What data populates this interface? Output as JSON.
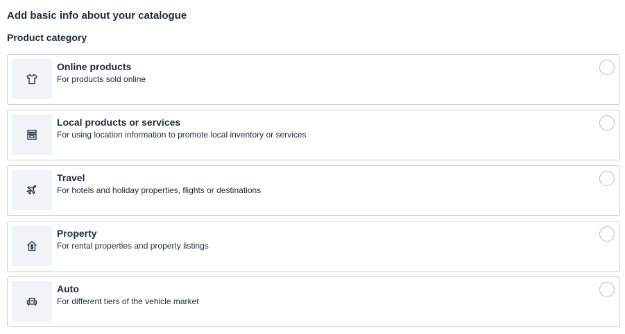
{
  "header": {
    "title": "Add basic info about your catalogue",
    "section_label": "Product category"
  },
  "options": [
    {
      "title": "Online products",
      "description": "For products sold online",
      "icon": "shirt-icon",
      "selected": false
    },
    {
      "title": "Local products or services",
      "description": "For using location information to promote local inventory or services",
      "icon": "storefront-icon",
      "selected": false
    },
    {
      "title": "Travel",
      "description": "For hotels and holiday properties, flights or destinations",
      "icon": "airplane-icon",
      "selected": false
    },
    {
      "title": "Property",
      "description": "For rental properties and property listings",
      "icon": "house-dollar-icon",
      "selected": false
    },
    {
      "title": "Auto",
      "description": "For different tiers of the vehicle market",
      "icon": "car-icon",
      "selected": false
    }
  ]
}
